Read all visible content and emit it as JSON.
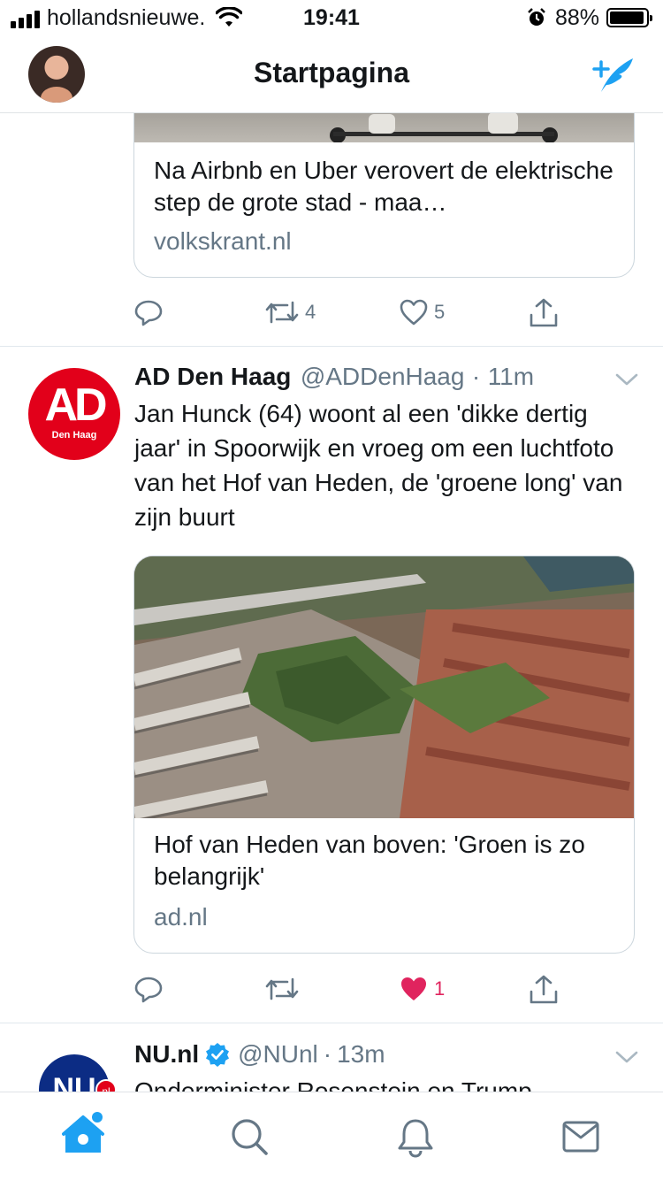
{
  "status_bar": {
    "carrier": "hollandsnieuwe.",
    "time": "19:41",
    "battery_percent": "88%"
  },
  "nav": {
    "title": "Startpagina"
  },
  "tweets": [
    {
      "card": {
        "title": "Na Airbnb en Uber verovert de elektrische step de grote stad - maa…",
        "domain": "volkskrant.nl"
      },
      "actions": {
        "reply_count": "",
        "retweet_count": "4",
        "like_count": "5",
        "liked": false
      }
    },
    {
      "name": "AD Den Haag",
      "handle": "@ADDenHaag",
      "separator": "·",
      "time": "11m",
      "avatar_text": "AD",
      "avatar_subtext": "Den Haag",
      "text": "Jan Hunck (64) woont al een 'dikke dertig jaar' in Spoorwijk en vroeg om een luchtfoto van het Hof van Heden, de 'groene long' van zijn buurt",
      "card": {
        "title": "Hof van Heden van boven: 'Groen is zo belangrijk'",
        "domain": "ad.nl"
      },
      "actions": {
        "reply_count": "",
        "retweet_count": "",
        "like_count": "1",
        "liked": true
      }
    },
    {
      "name": "NU.nl",
      "handle": "@NUnl",
      "separator": "·",
      "time": "13m",
      "avatar_text": "NU",
      "avatar_badge": "nl",
      "verified": true,
      "text": "Onderminister Rosenstein en Trump"
    }
  ],
  "tabs": [
    "home",
    "search",
    "notifications",
    "messages"
  ],
  "colors": {
    "accent": "#1da1f2",
    "like": "#e0245e",
    "secondary_text": "#657786",
    "ad_red": "#e2001a",
    "nu_blue": "#0c2c84"
  }
}
